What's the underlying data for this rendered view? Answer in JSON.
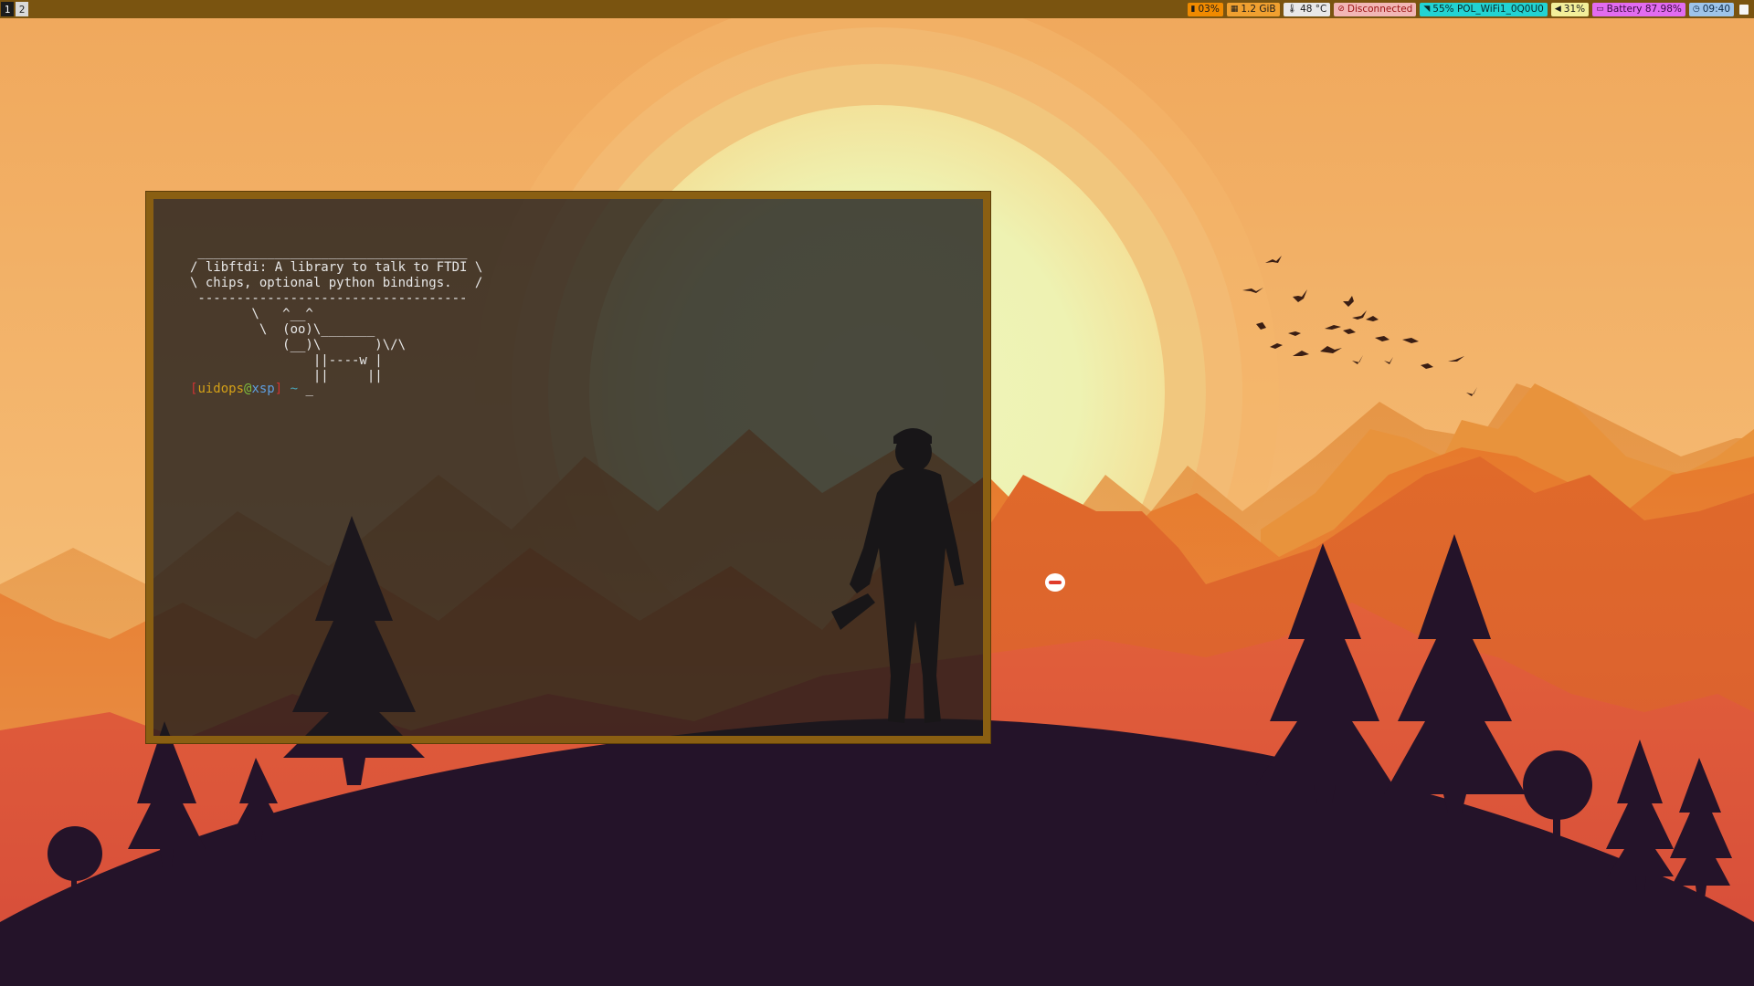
{
  "workspaces": [
    {
      "label": "1",
      "active": true
    },
    {
      "label": "2",
      "active": false
    }
  ],
  "status": {
    "cpu": {
      "icon": "cpu-icon",
      "value": "03%",
      "bg": "#f08a00",
      "fg": "#1a1a1a"
    },
    "memory": {
      "icon": "memory-icon",
      "value": "1.2 GiB",
      "bg": "#f0a030",
      "fg": "#1a1a1a"
    },
    "temperature": {
      "icon": "thermometer-icon",
      "value": "48 °C",
      "bg": "#e8e8e8",
      "fg": "#1a1a1a"
    },
    "ethernet": {
      "icon": "ethernet-icon",
      "value": "Disconnected",
      "bg": "#f2b6b6",
      "fg": "#9a1010"
    },
    "wifi": {
      "icon": "wifi-icon",
      "value": "55% POL_WiFi1_0Q0U0",
      "bg": "#22d3d3",
      "fg": "#0a2a2a"
    },
    "volume": {
      "icon": "volume-icon",
      "value": "31%",
      "bg": "#f3ef9a",
      "fg": "#1a1a1a"
    },
    "battery": {
      "icon": "battery-icon",
      "value": "Battery 87.98%",
      "bg": "#e26cf0",
      "fg": "#3a0a40"
    },
    "clock": {
      "icon": "clock-icon",
      "value": "09:40",
      "bg": "#9ec4ea",
      "fg": "#102a44"
    }
  },
  "terminal": {
    "output": " ___________________________________\n/ libftdi: A library to talk to FTDI \\\n\\ chips, optional python bindings.   /\n -----------------------------------\n        \\   ^__^\n         \\  (oo)\\_______\n            (__)\\       )\\/\\\n                ||----w |\n                ||     ||",
    "prompt": {
      "open_bracket": "[",
      "user": "uidops",
      "at": "@",
      "host": "xsp",
      "close_bracket": "]",
      "path": " ~",
      "cursor": " _"
    },
    "colors": {
      "bracket": "#cc3333",
      "user": "#d4a017",
      "at": "#7fbf3f",
      "host": "#5e9ee0",
      "path": "#4aa3b5"
    }
  }
}
